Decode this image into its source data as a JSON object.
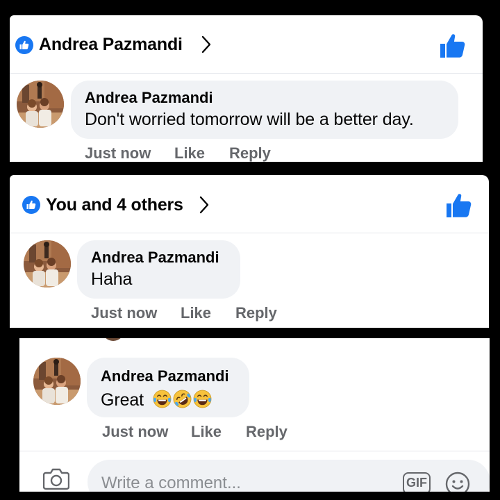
{
  "panels": [
    {
      "reaction_summary": "Andrea Pazmandi",
      "comment": {
        "author": "Andrea Pazmandi",
        "text": "Don't worried tomorrow will be a better day.",
        "timestamp": "Just now",
        "like_label": "Like",
        "reply_label": "Reply"
      }
    },
    {
      "reaction_summary": "You and 4 others",
      "comment": {
        "author": "Andrea Pazmandi",
        "text": "Haha",
        "timestamp": "Just now",
        "like_label": "Like",
        "reply_label": "Reply"
      }
    },
    {
      "comment": {
        "author": "Andrea Pazmandi",
        "text": "Great",
        "emojis": [
          "tears-of-joy-emoji",
          "rolling-laughing-emoji",
          "tears-of-joy-emoji"
        ],
        "timestamp": "Just now",
        "like_label": "Like",
        "reply_label": "Reply"
      }
    }
  ],
  "composer": {
    "placeholder": "Write a comment...",
    "gif_label": "GIF",
    "icons": [
      "camera-icon",
      "gif-icon",
      "smiley-icon"
    ]
  },
  "colors": {
    "accent": "#1877f2",
    "bubble": "#f0f2f5",
    "meta_text": "#65676b",
    "background": "#000000"
  }
}
